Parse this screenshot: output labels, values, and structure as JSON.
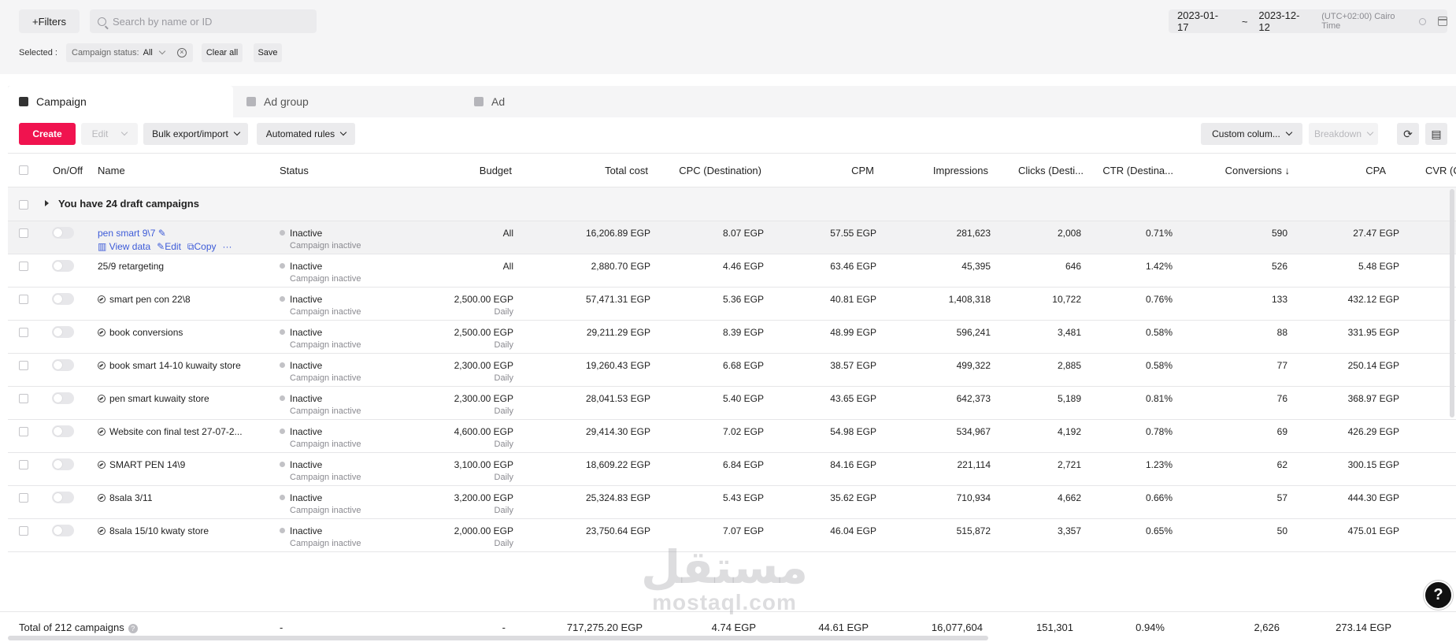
{
  "filters_label": "+Filters",
  "search_placeholder": "Search by name or ID",
  "date_start": "2023-01-17",
  "date_sep": "~",
  "date_end": "2023-12-12",
  "timezone": "(UTC+02:00) Cairo Time",
  "selected_label": "Selected :",
  "campaign_status_chip": {
    "label": "Campaign status:",
    "value": "All"
  },
  "clear_all": "Clear all",
  "save": "Save",
  "tabs": [
    {
      "label": "Campaign"
    },
    {
      "label": "Ad group"
    },
    {
      "label": "Ad"
    }
  ],
  "toolbar": {
    "create": "Create",
    "edit": "Edit",
    "bulk": "Bulk export/import",
    "rules": "Automated rules",
    "custom_cols": "Custom colum...",
    "breakdown": "Breakdown"
  },
  "columns": {
    "onoff": "On/Off",
    "name": "Name",
    "status": "Status",
    "budget": "Budget",
    "total_cost": "Total cost",
    "cpc": "CPC (Destination)",
    "cpm": "CPM",
    "impressions": "Impressions",
    "clicks": "Clicks (Desti...",
    "ctr": "CTR (Destina...",
    "conversions": "Conversions ↓",
    "cpa": "CPA",
    "cvr": "CVR (C"
  },
  "draft_text": "You have 24 draft campaigns",
  "row_actions": {
    "view": "View data",
    "edit": "Edit",
    "copy": "Copy",
    "more": "···"
  },
  "rows": [
    {
      "name": "pen smart 9\\7",
      "status": "Inactive",
      "status_sub": "Campaign inactive",
      "budget": "All",
      "budget_sub": "",
      "total_cost": "16,206.89 EGP",
      "cpc": "8.07 EGP",
      "cpm": "57.55 EGP",
      "impressions": "281,623",
      "clicks": "2,008",
      "ctr": "0.71%",
      "conversions": "590",
      "cpa": "27.47 EGP"
    },
    {
      "name": "25/9 retargeting",
      "status": "Inactive",
      "status_sub": "Campaign inactive",
      "budget": "All",
      "budget_sub": "",
      "total_cost": "2,880.70 EGP",
      "cpc": "4.46 EGP",
      "cpm": "63.46 EGP",
      "impressions": "45,395",
      "clicks": "646",
      "ctr": "1.42%",
      "conversions": "526",
      "cpa": "5.48 EGP"
    },
    {
      "name": "smart pen con 22\\8",
      "status": "Inactive",
      "status_sub": "Campaign inactive",
      "budget": "2,500.00 EGP",
      "budget_sub": "Daily",
      "total_cost": "57,471.31 EGP",
      "cpc": "5.36 EGP",
      "cpm": "40.81 EGP",
      "impressions": "1,408,318",
      "clicks": "10,722",
      "ctr": "0.76%",
      "conversions": "133",
      "cpa": "432.12 EGP"
    },
    {
      "name": "book conversions",
      "status": "Inactive",
      "status_sub": "Campaign inactive",
      "budget": "2,500.00 EGP",
      "budget_sub": "Daily",
      "total_cost": "29,211.29 EGP",
      "cpc": "8.39 EGP",
      "cpm": "48.99 EGP",
      "impressions": "596,241",
      "clicks": "3,481",
      "ctr": "0.58%",
      "conversions": "88",
      "cpa": "331.95 EGP"
    },
    {
      "name": "book smart 14-10 kuwaity store",
      "status": "Inactive",
      "status_sub": "Campaign inactive",
      "budget": "2,300.00 EGP",
      "budget_sub": "Daily",
      "total_cost": "19,260.43 EGP",
      "cpc": "6.68 EGP",
      "cpm": "38.57 EGP",
      "impressions": "499,322",
      "clicks": "2,885",
      "ctr": "0.58%",
      "conversions": "77",
      "cpa": "250.14 EGP"
    },
    {
      "name": "pen smart kuwaity store",
      "status": "Inactive",
      "status_sub": "Campaign inactive",
      "budget": "2,300.00 EGP",
      "budget_sub": "Daily",
      "total_cost": "28,041.53 EGP",
      "cpc": "5.40 EGP",
      "cpm": "43.65 EGP",
      "impressions": "642,373",
      "clicks": "5,189",
      "ctr": "0.81%",
      "conversions": "76",
      "cpa": "368.97 EGP"
    },
    {
      "name": "Website con final test 27-07-2...",
      "status": "Inactive",
      "status_sub": "Campaign inactive",
      "budget": "4,600.00 EGP",
      "budget_sub": "Daily",
      "total_cost": "29,414.30 EGP",
      "cpc": "7.02 EGP",
      "cpm": "54.98 EGP",
      "impressions": "534,967",
      "clicks": "4,192",
      "ctr": "0.78%",
      "conversions": "69",
      "cpa": "426.29 EGP"
    },
    {
      "name": "SMART PEN 14\\9",
      "status": "Inactive",
      "status_sub": "Campaign inactive",
      "budget": "3,100.00 EGP",
      "budget_sub": "Daily",
      "total_cost": "18,609.22 EGP",
      "cpc": "6.84 EGP",
      "cpm": "84.16 EGP",
      "impressions": "221,114",
      "clicks": "2,721",
      "ctr": "1.23%",
      "conversions": "62",
      "cpa": "300.15 EGP"
    },
    {
      "name": "8sala 3/11",
      "status": "Inactive",
      "status_sub": "Campaign inactive",
      "budget": "3,200.00 EGP",
      "budget_sub": "Daily",
      "total_cost": "25,324.83 EGP",
      "cpc": "5.43 EGP",
      "cpm": "35.62 EGP",
      "impressions": "710,934",
      "clicks": "4,662",
      "ctr": "0.66%",
      "conversions": "57",
      "cpa": "444.30 EGP"
    },
    {
      "name": "8sala 15/10 kwaty store",
      "status": "Inactive",
      "status_sub": "Campaign inactive",
      "budget": "2,000.00 EGP",
      "budget_sub": "Daily",
      "total_cost": "23,750.64 EGP",
      "cpc": "7.07 EGP",
      "cpm": "46.04 EGP",
      "impressions": "515,872",
      "clicks": "3,357",
      "ctr": "0.65%",
      "conversions": "50",
      "cpa": "475.01 EGP"
    }
  ],
  "total": {
    "label": "Total of 212 campaigns",
    "status": "-",
    "budget": "-",
    "total_cost": "717,275.20 EGP",
    "cpc": "4.74 EGP",
    "cpm": "44.61 EGP",
    "impressions": "16,077,604",
    "clicks": "151,301",
    "ctr": "0.94%",
    "conversions": "2,626",
    "cpa": "273.14 EGP"
  },
  "watermark": {
    "arabic": "مستقل",
    "latin": "mostaql.com"
  },
  "help": "?",
  "colors": {
    "accent": "#f0134f",
    "link": "#3d5bd8"
  },
  "icons": [
    "search-icon",
    "calendar-icon",
    "clear-icon",
    "folder-icon",
    "refresh-icon",
    "export-icon",
    "pencil-icon",
    "campaign-type-icon",
    "help-icon"
  ]
}
